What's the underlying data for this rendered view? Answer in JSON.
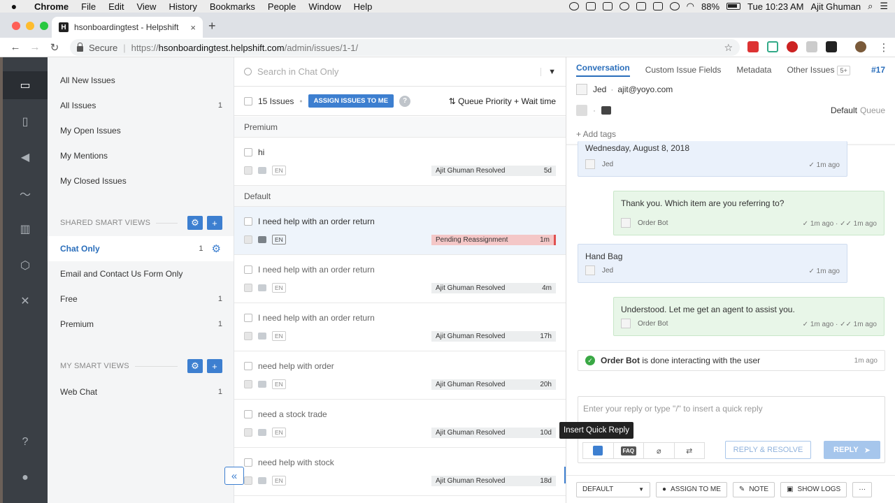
{
  "menubar": {
    "apple": "",
    "items": [
      "Chrome",
      "File",
      "Edit",
      "View",
      "History",
      "Bookmarks",
      "People",
      "Window",
      "Help"
    ],
    "battery": "88%",
    "clock": "Tue 10:23 AM",
    "user": "Ajit Ghuman"
  },
  "browser": {
    "tab_title": "hsonboardingtest - Helpshift",
    "tab_favicon": "H",
    "tab_close": "×",
    "new_tab": "+",
    "secure_label": "Secure",
    "url_scheme": "https://",
    "url_host": "hsonboardingtest.helpshift.com",
    "url_path": "/admin/issues/1-1/"
  },
  "sidebar": {
    "views": [
      {
        "label": "All New Issues",
        "count": ""
      },
      {
        "label": "All Issues",
        "count": "1"
      },
      {
        "label": "My Open Issues",
        "count": ""
      },
      {
        "label": "My Mentions",
        "count": ""
      },
      {
        "label": "My Closed Issues",
        "count": ""
      }
    ],
    "shared_header": "SHARED SMART VIEWS",
    "shared": [
      {
        "label": "Chat Only",
        "count": "1"
      },
      {
        "label": "Email and Contact Us Form Only",
        "count": ""
      },
      {
        "label": "Free",
        "count": "1"
      },
      {
        "label": "Premium",
        "count": "1"
      }
    ],
    "my_header": "MY SMART VIEWS",
    "mine": [
      {
        "label": "Web Chat",
        "count": "1"
      }
    ]
  },
  "list": {
    "search_placeholder": "Search in Chat Only",
    "issue_count": "15 Issues",
    "assign_label": "ASSIGN ISSUES TO ME",
    "help": "?",
    "sort_label": "Queue Priority + Wait time",
    "groups": [
      "Premium",
      "Default"
    ],
    "issues": [
      {
        "title": "hi",
        "lang": "EN",
        "status": "Ajit Ghuman Resolved",
        "age": "5d"
      },
      {
        "title": "I need help with an order return",
        "lang": "EN",
        "status": "Pending Reassignment",
        "age": "1m"
      },
      {
        "title": "I need help with an order return",
        "lang": "EN",
        "status": "Ajit Ghuman Resolved",
        "age": "4m"
      },
      {
        "title": "I need help with an order return",
        "lang": "EN",
        "status": "Ajit Ghuman Resolved",
        "age": "17h"
      },
      {
        "title": "need help with order",
        "lang": "EN",
        "status": "Ajit Ghuman Resolved",
        "age": "20h"
      },
      {
        "title": "need a stock trade",
        "lang": "EN",
        "status": "Ajit Ghuman Resolved",
        "age": "10d"
      },
      {
        "title": "need help with stock",
        "lang": "EN",
        "status": "Ajit Ghuman Resolved",
        "age": "18d"
      }
    ],
    "collapse": "«"
  },
  "conversation": {
    "tabs": [
      "Conversation",
      "Custom Issue Fields",
      "Metadata",
      "Other Issues"
    ],
    "other_badge": "5+",
    "issue_number": "#17",
    "customer_name": "Jed",
    "customer_email": "ajit@yoyo.com",
    "dot": "·",
    "queue_name": "Default",
    "queue_suffix": "Queue",
    "add_tags": "+ Add tags",
    "messages": [
      {
        "text": "Wednesday, August 8, 2018",
        "author": "Jed",
        "time": "1m ago"
      },
      {
        "text": "Thank you. Which item are you referring to?",
        "author": "Order Bot",
        "time": "1m ago",
        "time2": "1m ago"
      },
      {
        "text": "Hand Bag",
        "author": "Jed",
        "time": "1m ago"
      },
      {
        "text": "Understood. Let me get an agent to assist you.",
        "author": "Order Bot",
        "time": "1m ago",
        "time2": "1m ago"
      }
    ],
    "done_actor": "Order Bot",
    "done_text": "is done interacting with the user",
    "done_time": "1m ago",
    "reply_placeholder": "Enter your reply or type \"/\" to insert a quick reply",
    "tooltip": "Insert Quick Reply",
    "faq": "FAQ",
    "reply_resolve": "REPLY & RESOLVE",
    "reply": "REPLY",
    "bottom": {
      "queue_select": "DEFAULT",
      "assign": "ASSIGN TO ME",
      "note": "NOTE",
      "logs": "SHOW LOGS",
      "more": "···"
    }
  },
  "colors": {
    "accent": "#3d7fd0",
    "user_bubble": "#eaf1fb",
    "bot_bubble": "#e8f6e8",
    "pending": "#f4c7c7"
  }
}
